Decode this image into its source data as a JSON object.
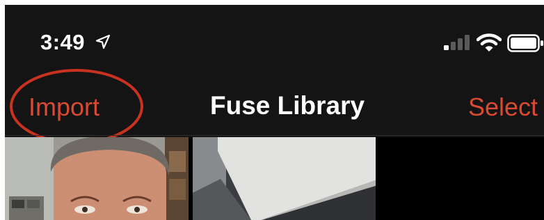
{
  "status_bar": {
    "time": "3:49",
    "icons": [
      "location-arrow-icon",
      "cellular-signal-icon",
      "wifi-icon",
      "battery-icon"
    ]
  },
  "nav": {
    "left_label": "Import",
    "title": "Fuse Library",
    "right_label": "Select"
  },
  "colors": {
    "background": "#141414",
    "accent": "#d94a34",
    "annotation_circle": "#c8321f",
    "text": "#ffffff"
  },
  "photos": [
    {
      "name": "photo-thumbnail-selfie"
    },
    {
      "name": "photo-thumbnail-table-corner"
    }
  ]
}
